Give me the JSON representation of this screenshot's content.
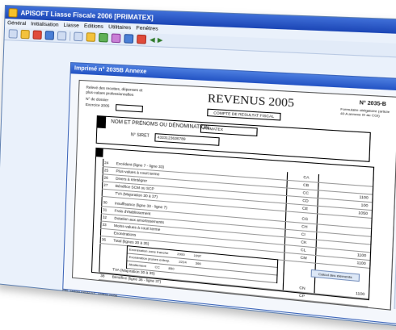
{
  "app": {
    "title": "APISOFT Liasse Fiscale 2006 [PRIMATEX]"
  },
  "menu": [
    "Général",
    "Initialisation",
    "Liasse",
    "Editions",
    "Utilitaires",
    "Fenêtres"
  ],
  "inner_window": {
    "title": "Imprimé n° 2035B  Annexe"
  },
  "form": {
    "header_left": "Relevé des recettes, dépenses et plus-values professionnelles",
    "exercice_label": "N° de dossier",
    "exercice_label2": "Exercice 2005",
    "title": "REVENUS 2005",
    "code": "N° 2035-B",
    "code_note": "Formulaire obligatoire (article 40 A annexe III au CGI)",
    "regime": "COMPTE DE RESULTAT FISCAL",
    "section1_label": "NOM ET PRÉNOMS OU DÉNOMINATION",
    "section1_value": "PRIMATEX",
    "siret_label": "N° SIRET",
    "siret_value": "4333123636789",
    "rows": [
      {
        "num": "24",
        "label": "Excédent (ligne 7 - ligne 33)",
        "code": "CA",
        "value": ""
      },
      {
        "num": "25",
        "label": "Plus-values à court terme",
        "code": "CB",
        "value": ""
      },
      {
        "num": "26",
        "label": "Divers à réintégrer",
        "code": "CC",
        "value": "1100"
      },
      {
        "num": "27",
        "label": "Bénéfice SCM ou SCP",
        "code": "CD",
        "value": "100"
      },
      {
        "num": "",
        "label": "TVA (Majoration 30 à 37)",
        "code": "CE",
        "value": "1050"
      },
      {
        "num": "30",
        "label": "Insuffisance (ligne 33 - ligne 7)",
        "code": "CG",
        "value": ""
      },
      {
        "num": "31",
        "label": "Frais d'établissement",
        "code": "CH",
        "value": ""
      },
      {
        "num": "32",
        "label": "Dotation aux amortissements",
        "code": "CI",
        "value": ""
      },
      {
        "num": "33",
        "label": "Moins-values à court terme",
        "code": "CK",
        "value": ""
      },
      {
        "num": "",
        "label": "Exonérations",
        "code": "CL",
        "value": "1100"
      },
      {
        "num": "36",
        "label": "Total (lignes 30 à 35)",
        "code": "CM",
        "value": "1100"
      },
      {
        "num": "",
        "label": "TVA (Majoration 30 à 35)",
        "code": "CN",
        "value": "1100"
      },
      {
        "num": "38",
        "label": "Bénéfice (ligne 36 - ligne 37)",
        "code": "CP",
        "value": ""
      }
    ],
    "mid_rows": [
      [
        "Exonération zone franche",
        "2000",
        "1997"
      ],
      [
        "Exonération jeunes entrep.",
        "2224",
        "300"
      ],
      [
        "Abattement",
        "CC",
        "850"
      ]
    ],
    "calc_button": "Calcul des éléments"
  },
  "status_text": "Prêt - Dossier PRIMATEX - Annexe 2035B"
}
